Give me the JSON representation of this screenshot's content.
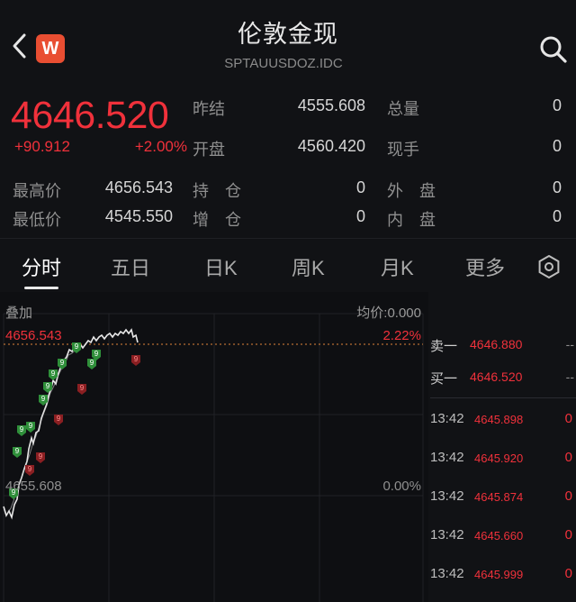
{
  "header": {
    "title": "伦敦金现",
    "code": "SPTAUUSDOZ.IDC",
    "logo_letter": "W"
  },
  "quote": {
    "price": "4646.520",
    "change": "+90.912",
    "change_pct": "+2.00%",
    "prev_close_label": "昨结",
    "prev_close": "4555.608",
    "open_label": "开盘",
    "open": "4560.420",
    "total_vol_label": "总量",
    "total_vol": "0",
    "cur_vol_label": "现手",
    "cur_vol": "0",
    "high_label": "最高价",
    "high": "4656.543",
    "low_label": "最低价",
    "low": "4545.550",
    "hold_label": "持　仓",
    "hold": "0",
    "add_label": "增　仓",
    "add": "0",
    "outer_label": "外　盘",
    "outer": "0",
    "inner_label": "内　盘",
    "inner": "0"
  },
  "tabs": [
    "分时",
    "五日",
    "日K",
    "周K",
    "月K",
    "更多"
  ],
  "chart": {
    "overlay_label": "叠加",
    "avg_label": "均价:0.000",
    "high_label": "4656.543",
    "high_pct": "2.22%",
    "base_label": "4655.608",
    "base_pct": "0.00%",
    "marker_text": "9"
  },
  "orderbook": {
    "sell_label": "卖一",
    "sell_price": "4646.880",
    "sell_vol": "--",
    "buy_label": "买一",
    "buy_price": "4646.520",
    "buy_vol": "--"
  },
  "trades": [
    {
      "time": "13:42",
      "price": "4645.898",
      "vol": "0"
    },
    {
      "time": "13:42",
      "price": "4645.920",
      "vol": "0"
    },
    {
      "time": "13:42",
      "price": "4645.874",
      "vol": "0"
    },
    {
      "time": "13:42",
      "price": "4645.660",
      "vol": "0"
    },
    {
      "time": "13:42",
      "price": "4645.999",
      "vol": "0"
    }
  ],
  "colors": {
    "up": "#f0313b",
    "accent": "#e94e32",
    "green_marker": "#2f8f3a",
    "red_marker": "#8a1f22"
  }
}
